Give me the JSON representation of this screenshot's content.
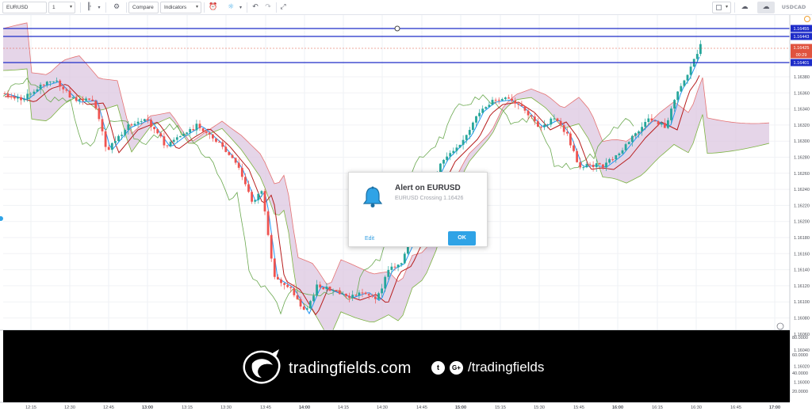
{
  "toolbar": {
    "symbol": "EURUSD",
    "interval": "1",
    "compare_label": "Compare",
    "indicators_label": "Indicators",
    "right_symbol": "USDCAD"
  },
  "alert": {
    "title": "Alert on EURUSD",
    "subtitle": "EURUSD Crossing 1.16426",
    "edit_label": "Edit",
    "ok_label": "OK"
  },
  "banner": {
    "brand": "tradingfields.com",
    "handle": "/tradingfields",
    "twitter_glyph": "t",
    "google_glyph": "G+"
  },
  "price_axis": {
    "ticks": [
      "1.16380",
      "1.16360",
      "1.16340",
      "1.16320",
      "1.16300",
      "1.16280",
      "1.16260",
      "1.16240",
      "1.16220",
      "1.16200",
      "1.16180",
      "1.16160",
      "1.16140",
      "1.16120",
      "1.16100",
      "1.16080",
      "1.16060",
      "1.16040",
      "1.16020",
      "1.16000"
    ],
    "badges": [
      {
        "label": "1.16455",
        "color": "#1e2cc8"
      },
      {
        "label": "1.16443",
        "color": "#1e2cc8"
      },
      {
        "label": "1.16425",
        "color": "#e0533f"
      },
      {
        "label": "00:29",
        "color": "#e0533f"
      },
      {
        "label": "1.16401",
        "color": "#1e2cc8"
      }
    ]
  },
  "oscillator_axis": {
    "ticks": [
      "80.0000",
      "60.0000",
      "40.0000",
      "20.0000"
    ]
  },
  "time_axis": {
    "ticks": [
      "12:15",
      "12:30",
      "12:45",
      "13:00",
      "13:15",
      "13:30",
      "13:45",
      "14:00",
      "14:15",
      "14:30",
      "14:45",
      "15:00",
      "15:15",
      "15:30",
      "15:45",
      "16:00",
      "16:15",
      "16:30",
      "16:45",
      "17:00"
    ]
  },
  "colors": {
    "bull": "#26a69a",
    "bear": "#ef5350",
    "tenkan": "#2196f3",
    "kijun": "#b71c1c",
    "chikou": "#6aa84f",
    "cloud": "#dcc7e0",
    "alert_line": "#1e2cc8"
  },
  "icons": {
    "bar_style": "candlestick-icon",
    "settings": "gear-icon",
    "undo": "undo-icon",
    "redo": "redo-icon",
    "fullscreen": "fullscreen-icon"
  }
}
